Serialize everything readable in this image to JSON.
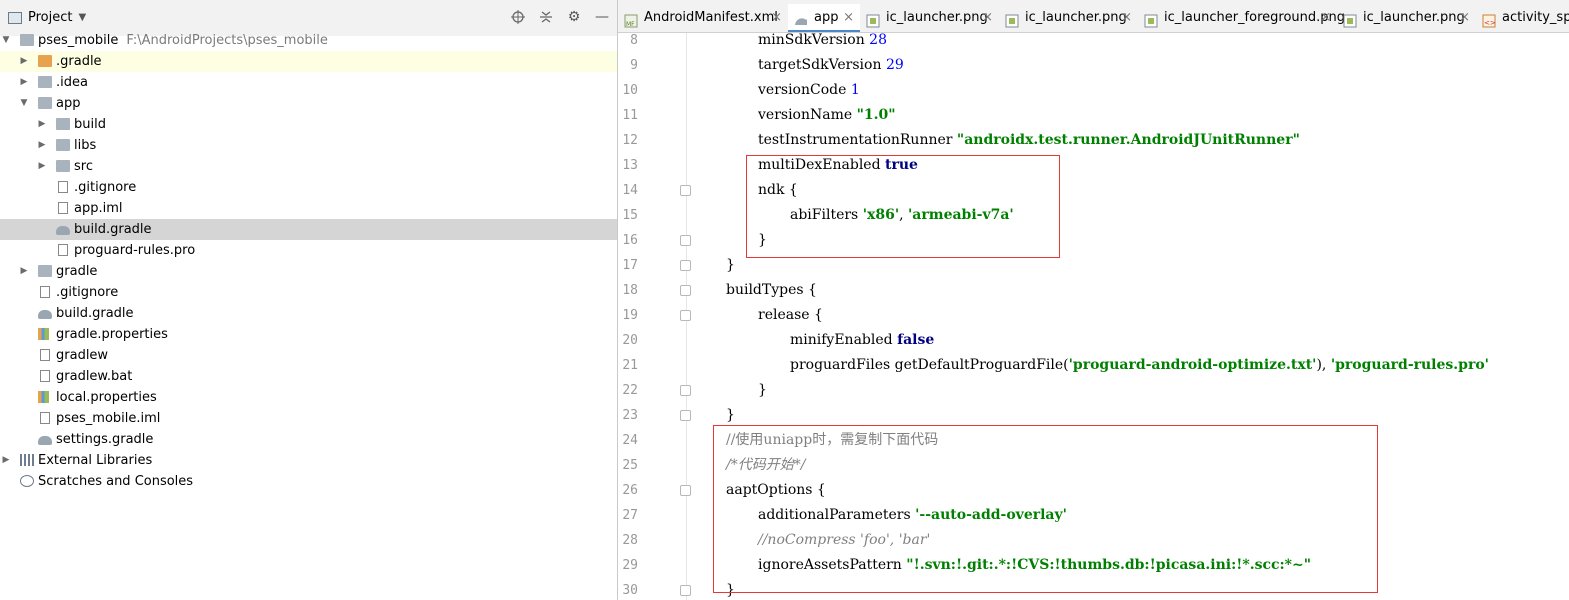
{
  "project_panel": {
    "title": "Project",
    "tools": [
      "locate-icon",
      "collapse-icon",
      "gear-icon",
      "minimize-icon"
    ],
    "tree": [
      {
        "label": "pses_mobile",
        "path": "F:\\AndroidProjects\\pses_mobile",
        "depth": 0,
        "expanded": true,
        "icon": "module-folder-icon"
      },
      {
        "label": ".gradle",
        "depth": 1,
        "expanded": false,
        "icon": "orange-folder-icon",
        "highlight": true
      },
      {
        "label": ".idea",
        "depth": 1,
        "expanded": false,
        "icon": "folder-icon"
      },
      {
        "label": "app",
        "depth": 1,
        "expanded": true,
        "icon": "module-folder-icon"
      },
      {
        "label": "build",
        "depth": 2,
        "expanded": false,
        "icon": "folder-icon"
      },
      {
        "label": "libs",
        "depth": 2,
        "expanded": false,
        "icon": "folder-icon"
      },
      {
        "label": "src",
        "depth": 2,
        "expanded": false,
        "icon": "folder-icon"
      },
      {
        "label": ".gitignore",
        "depth": 2,
        "icon": "file-icon"
      },
      {
        "label": "app.iml",
        "depth": 2,
        "icon": "iml-icon"
      },
      {
        "label": "build.gradle",
        "depth": 2,
        "icon": "gradle-icon",
        "selected": true
      },
      {
        "label": "proguard-rules.pro",
        "depth": 2,
        "icon": "file-icon"
      },
      {
        "label": "gradle",
        "depth": 1,
        "expanded": false,
        "icon": "folder-icon"
      },
      {
        "label": ".gitignore",
        "depth": 1,
        "icon": "file-icon"
      },
      {
        "label": "build.gradle",
        "depth": 1,
        "icon": "gradle-icon"
      },
      {
        "label": "gradle.properties",
        "depth": 1,
        "icon": "properties-icon"
      },
      {
        "label": "gradlew",
        "depth": 1,
        "icon": "file-icon"
      },
      {
        "label": "gradlew.bat",
        "depth": 1,
        "icon": "file-icon"
      },
      {
        "label": "local.properties",
        "depth": 1,
        "icon": "properties-icon"
      },
      {
        "label": "pses_mobile.iml",
        "depth": 1,
        "icon": "iml-icon"
      },
      {
        "label": "settings.gradle",
        "depth": 1,
        "icon": "gradle-icon"
      },
      {
        "label": "External Libraries",
        "depth": 0,
        "expanded": false,
        "icon": "libraries-icon"
      },
      {
        "label": "Scratches and Consoles",
        "depth": 0,
        "icon": "scratches-icon"
      }
    ]
  },
  "tabs": [
    {
      "label": "AndroidManifest.xml",
      "icon": "manifest-icon",
      "active": false
    },
    {
      "label": "app",
      "icon": "gradle-icon",
      "active": true
    },
    {
      "label": "ic_launcher.png",
      "icon": "image-icon",
      "active": false
    },
    {
      "label": "ic_launcher.png",
      "icon": "image-icon",
      "active": false
    },
    {
      "label": "ic_launcher_foreground.png",
      "icon": "image-icon",
      "active": false
    },
    {
      "label": "ic_launcher.png",
      "icon": "image-icon",
      "active": false
    },
    {
      "label": "activity_sp",
      "icon": "layout-icon",
      "active": false
    }
  ],
  "colors": {
    "keyword": "#000080",
    "number": "#0000ff",
    "string": "#008000",
    "comment": "#808080",
    "highlight_box": "#e53935"
  },
  "code": [
    {
      "n": "8",
      "indent": 2,
      "tokens": [
        [
          "plain",
          "minSdkVersion "
        ],
        [
          "num",
          "28"
        ]
      ]
    },
    {
      "n": "9",
      "indent": 2,
      "tokens": [
        [
          "plain",
          "targetSdkVersion "
        ],
        [
          "num",
          "29"
        ]
      ]
    },
    {
      "n": "10",
      "indent": 2,
      "tokens": [
        [
          "plain",
          "versionCode "
        ],
        [
          "num",
          "1"
        ]
      ]
    },
    {
      "n": "11",
      "indent": 2,
      "tokens": [
        [
          "plain",
          "versionName "
        ],
        [
          "str",
          "\"1.0\""
        ]
      ]
    },
    {
      "n": "12",
      "indent": 2,
      "tokens": [
        [
          "plain",
          "testInstrumentationRunner "
        ],
        [
          "str",
          "\"androidx.test.runner.AndroidJUnitRunner\""
        ]
      ]
    },
    {
      "n": "13",
      "indent": 2,
      "tokens": [
        [
          "plain",
          "multiDexEnabled "
        ],
        [
          "kw",
          "true"
        ]
      ]
    },
    {
      "n": "14",
      "indent": 2,
      "fold": true,
      "tokens": [
        [
          "plain",
          "ndk {"
        ]
      ]
    },
    {
      "n": "15",
      "indent": 3,
      "tokens": [
        [
          "plain",
          "abiFilters "
        ],
        [
          "str",
          "'x86'"
        ],
        [
          "plain",
          ", "
        ],
        [
          "str",
          "'armeabi-v7a'"
        ]
      ]
    },
    {
      "n": "16",
      "indent": 2,
      "fold": true,
      "tokens": [
        [
          "plain",
          "}"
        ]
      ]
    },
    {
      "n": "17",
      "indent": 1,
      "fold": true,
      "tokens": [
        [
          "plain",
          "}"
        ]
      ]
    },
    {
      "n": "18",
      "indent": 1,
      "fold": true,
      "tokens": [
        [
          "plain",
          "buildTypes {"
        ]
      ]
    },
    {
      "n": "19",
      "indent": 2,
      "fold": true,
      "tokens": [
        [
          "plain",
          "release {"
        ]
      ]
    },
    {
      "n": "20",
      "indent": 3,
      "tokens": [
        [
          "plain",
          "minifyEnabled "
        ],
        [
          "kw",
          "false"
        ]
      ]
    },
    {
      "n": "21",
      "indent": 3,
      "tokens": [
        [
          "plain",
          "proguardFiles getDefaultProguardFile("
        ],
        [
          "str",
          "'proguard-android-optimize.txt'"
        ],
        [
          "plain",
          "), "
        ],
        [
          "str",
          "'proguard-rules.pro'"
        ]
      ]
    },
    {
      "n": "22",
      "indent": 2,
      "fold": true,
      "tokens": [
        [
          "plain",
          "}"
        ]
      ]
    },
    {
      "n": "23",
      "indent": 1,
      "fold": true,
      "tokens": [
        [
          "plain",
          "}"
        ]
      ]
    },
    {
      "n": "24",
      "indent": 1,
      "tokens": [
        [
          "cmt",
          "//使用uniapp时，需复制下面代码"
        ]
      ]
    },
    {
      "n": "25",
      "indent": 1,
      "tokens": [
        [
          "cmt-i",
          "/*代码开始*/"
        ]
      ]
    },
    {
      "n": "26",
      "indent": 1,
      "fold": true,
      "tokens": [
        [
          "plain",
          "aaptOptions {"
        ]
      ]
    },
    {
      "n": "27",
      "indent": 2,
      "tokens": [
        [
          "plain",
          "additionalParameters "
        ],
        [
          "str",
          "'--auto-add-overlay'"
        ]
      ]
    },
    {
      "n": "28",
      "indent": 2,
      "tokens": [
        [
          "cmt-i",
          "//noCompress 'foo', 'bar'"
        ]
      ]
    },
    {
      "n": "29",
      "indent": 2,
      "tokens": [
        [
          "plain",
          "ignoreAssetsPattern "
        ],
        [
          "str",
          "\"!.svn:!.git:.*:!CVS:!thumbs.db:!picasa.ini:!*.scc:*~\""
        ]
      ]
    },
    {
      "n": "30",
      "indent": 1,
      "fold": true,
      "tokens": [
        [
          "plain",
          "}"
        ]
      ]
    }
  ]
}
